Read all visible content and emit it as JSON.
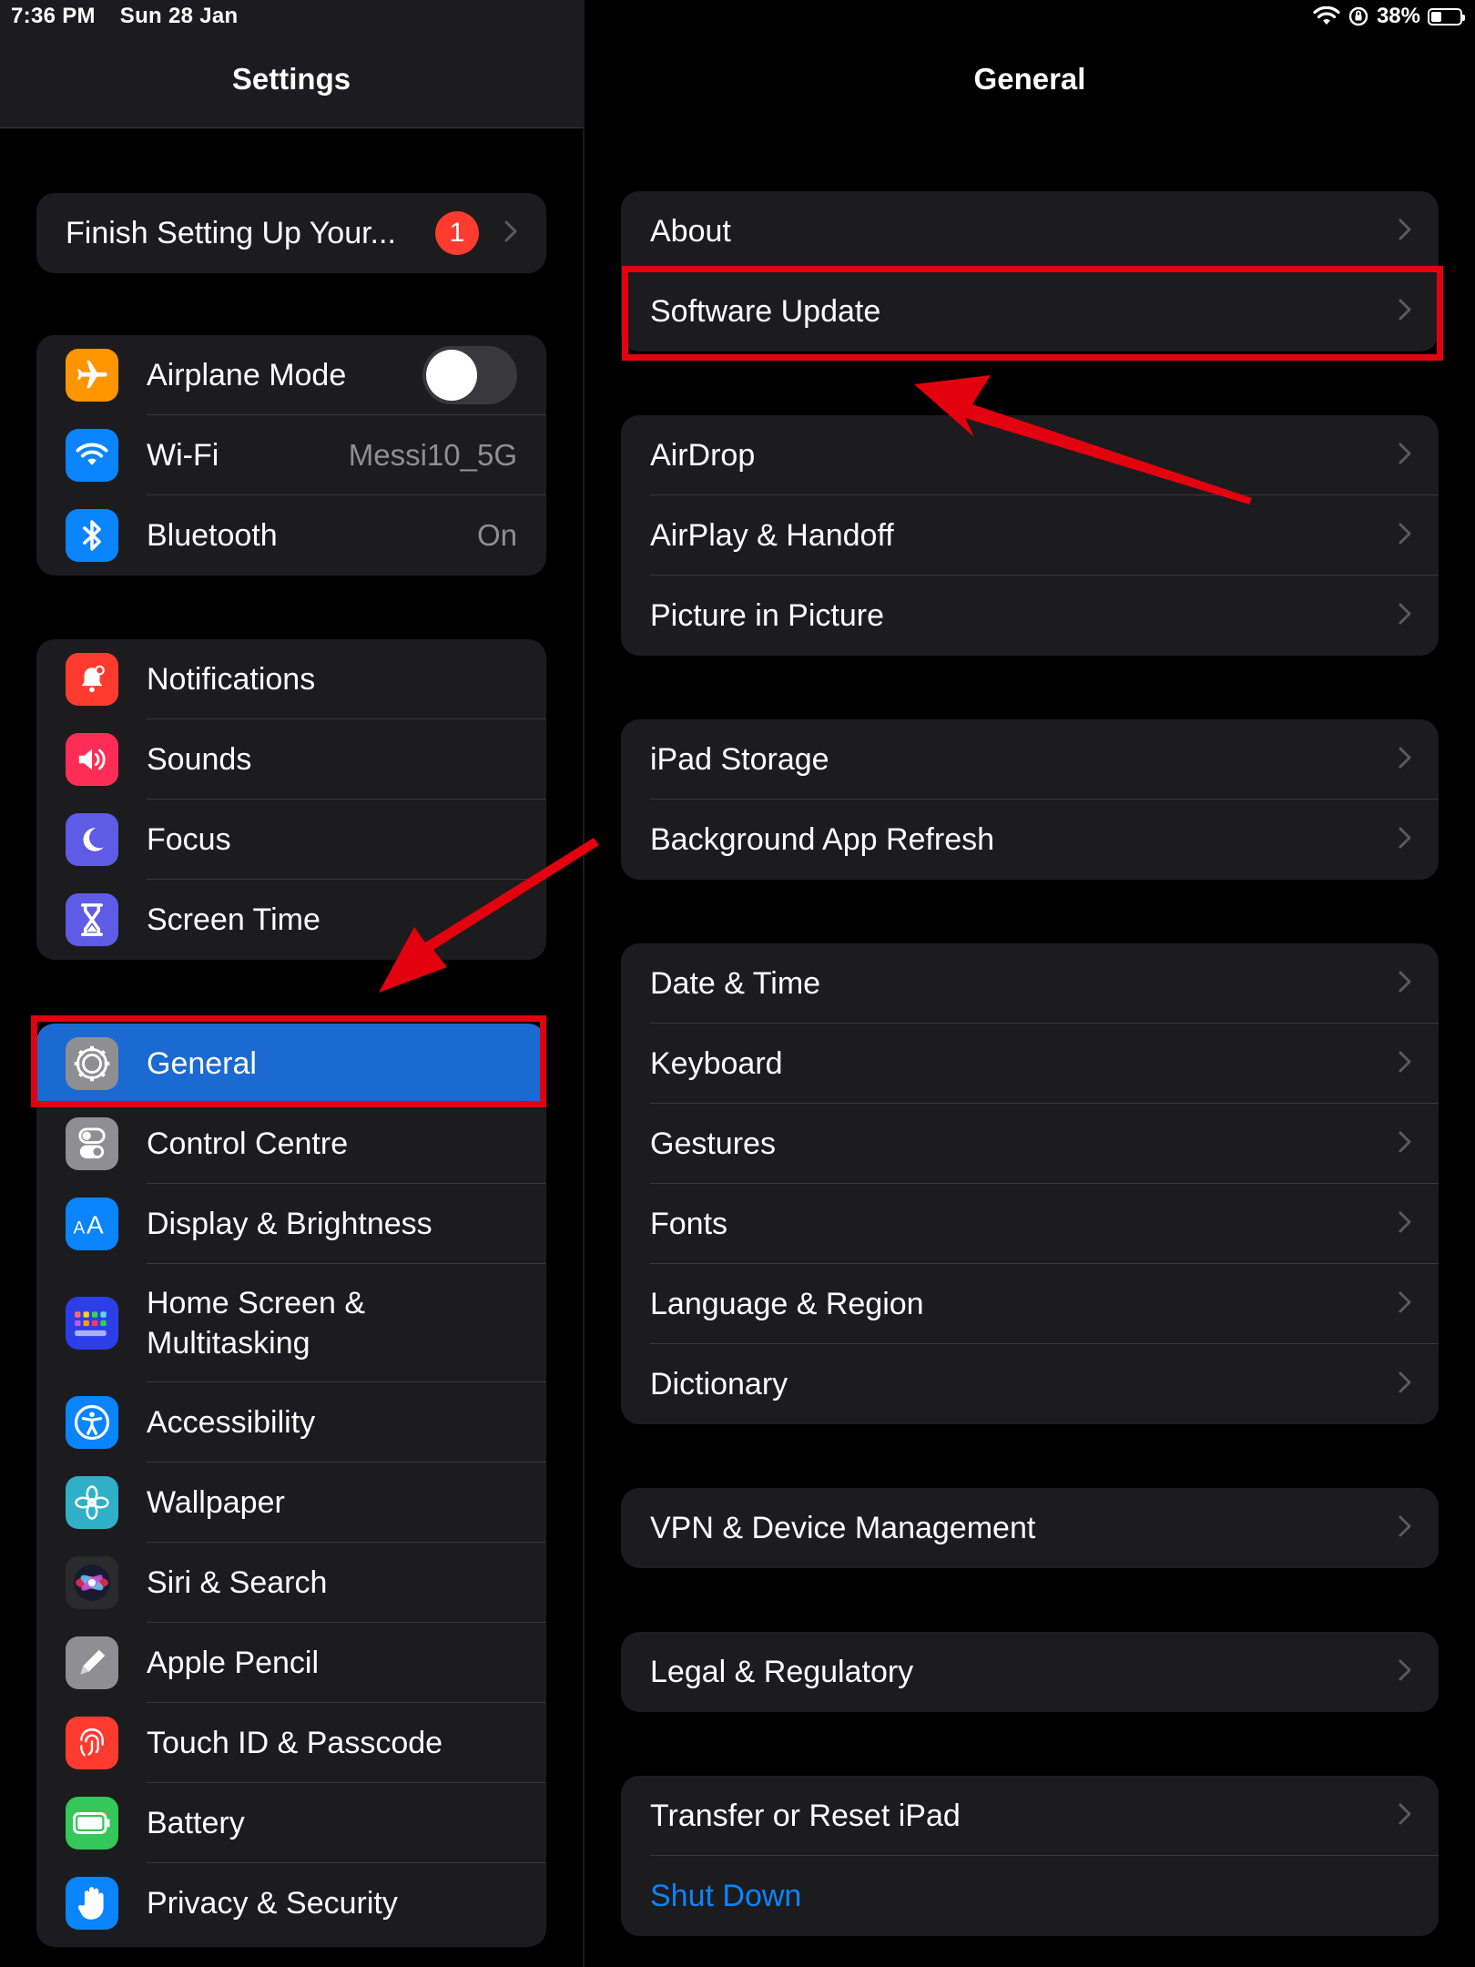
{
  "status_bar": {
    "time": "7:36 PM",
    "date": "Sun 28 Jan",
    "battery": "38%",
    "battery_level": 0.38
  },
  "sidebar": {
    "title": "Settings",
    "finish_setup": {
      "label": "Finish Setting Up Your...",
      "badge": "1"
    },
    "connectivity": [
      {
        "label": "Airplane Mode",
        "icon": "airplane-icon",
        "color": "#ff9500",
        "toggle_on": false
      },
      {
        "label": "Wi-Fi",
        "icon": "wifi-icon",
        "color": "#0a84ff",
        "value": "Messi10_5G"
      },
      {
        "label": "Bluetooth",
        "icon": "bluetooth-icon",
        "color": "#0a84ff",
        "value": "On"
      }
    ],
    "notifications_group": [
      {
        "label": "Notifications",
        "icon": "bell-icon",
        "color": "#ff3b30"
      },
      {
        "label": "Sounds",
        "icon": "speaker-icon",
        "color": "#ff2d55"
      },
      {
        "label": "Focus",
        "icon": "moon-icon",
        "color": "#5e5ce6"
      },
      {
        "label": "Screen Time",
        "icon": "hourglass-icon",
        "color": "#5e5ce6"
      }
    ],
    "general_group": [
      {
        "label": "General",
        "icon": "gear-icon",
        "color": "#8e8e93",
        "selected": true
      },
      {
        "label": "Control Centre",
        "icon": "switches-icon",
        "color": "#8e8e93"
      },
      {
        "label": "Display & Brightness",
        "icon": "text-size-icon",
        "color": "#0a84ff"
      },
      {
        "label": "Home Screen &\nMultitasking",
        "icon": "app-grid-icon",
        "color": "#2c3ee8"
      },
      {
        "label": "Accessibility",
        "icon": "accessibility-icon",
        "color": "#0a84ff"
      },
      {
        "label": "Wallpaper",
        "icon": "flower-icon",
        "color": "#30b0c7"
      },
      {
        "label": "Siri & Search",
        "icon": "siri-icon",
        "color": "#2b2b2e"
      },
      {
        "label": "Apple Pencil",
        "icon": "pencil-icon",
        "color": "#8e8e93"
      },
      {
        "label": "Touch ID & Passcode",
        "icon": "fingerprint-icon",
        "color": "#ff3b30"
      },
      {
        "label": "Battery",
        "icon": "battery-icon",
        "color": "#34c759"
      },
      {
        "label": "Privacy & Security",
        "icon": "hand-icon",
        "color": "#0a84ff"
      }
    ]
  },
  "detail": {
    "title": "General",
    "groups": [
      [
        "About",
        "Software Update"
      ],
      [
        "AirDrop",
        "AirPlay & Handoff",
        "Picture in Picture"
      ],
      [
        "iPad Storage",
        "Background App Refresh"
      ],
      [
        "Date & Time",
        "Keyboard",
        "Gestures",
        "Fonts",
        "Language & Region",
        "Dictionary"
      ],
      [
        "VPN & Device Management"
      ],
      [
        "Legal & Regulatory"
      ],
      [
        "Transfer or Reset iPad"
      ]
    ],
    "shut_down": "Shut Down"
  },
  "colors": {
    "accent": "#0a84ff",
    "selected": "#1a6ad1",
    "annotation": "#e3000f"
  }
}
